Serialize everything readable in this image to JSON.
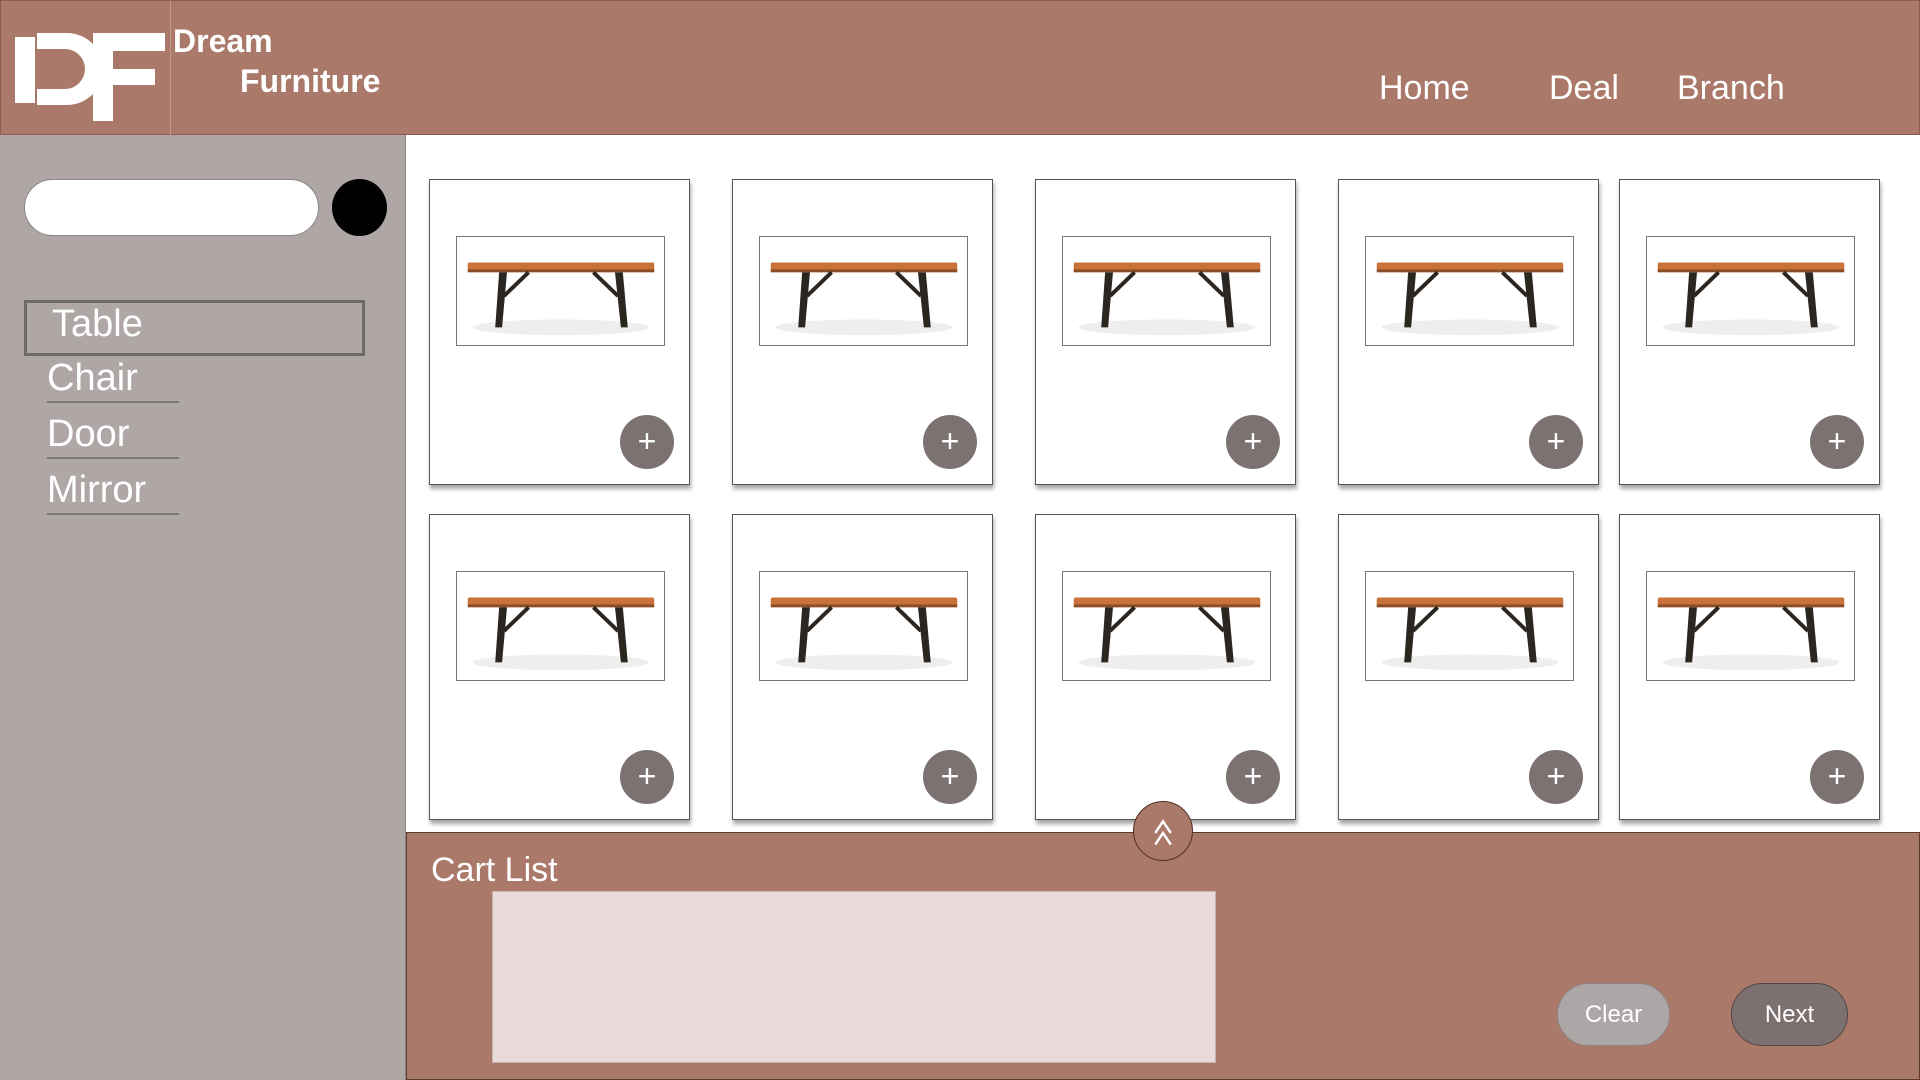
{
  "header": {
    "brand_line1": "Dream",
    "brand_line2": "Furniture",
    "logo_icon": "df-logo-icon",
    "nav": [
      {
        "label": "Home"
      },
      {
        "label": "Deal"
      },
      {
        "label": "Branch"
      }
    ]
  },
  "sidebar": {
    "search": {
      "value": "",
      "placeholder": ""
    },
    "search_icon": "search-button-circle",
    "categories": [
      {
        "label": "Table",
        "selected": true
      },
      {
        "label": "Chair",
        "selected": false
      },
      {
        "label": "Door",
        "selected": false
      },
      {
        "label": "Mirror",
        "selected": false
      }
    ]
  },
  "products": {
    "item_icon": "table-image",
    "add_label": "+",
    "count": 10
  },
  "cart": {
    "title": "Cart List",
    "clear_label": "Clear",
    "next_label": "Next",
    "collapse_icon": "chevron-up-icon"
  },
  "colors": {
    "brand": "#ab7969",
    "sidebar": "#afa6a6",
    "button_dark": "#7d7272",
    "button_light": "#aca6a6",
    "cart_list_bg": "#e8dad8"
  }
}
